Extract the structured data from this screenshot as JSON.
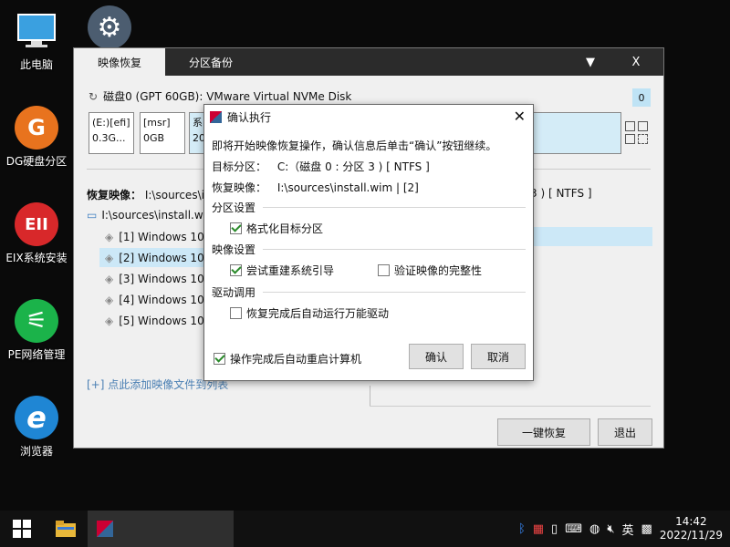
{
  "desktop": {
    "icons": [
      {
        "label": "此电脑",
        "glyph": "▭",
        "color": "#3a9ad9"
      },
      {
        "label": "DG硬盘分区",
        "glyph": "G",
        "color": "#e8731e"
      },
      {
        "label": "EIX系统安装",
        "glyph": "EII",
        "color": "#d8282a"
      },
      {
        "label": "PE网络管理",
        "glyph": "⚟",
        "color": "#1bb34a"
      },
      {
        "label": "浏览器",
        "glyph": "e",
        "color": "#1f86d4"
      }
    ],
    "settings_glyph": "⚙"
  },
  "window": {
    "tabs": [
      {
        "label": "映像恢复"
      },
      {
        "label": "分区备份"
      }
    ],
    "dropdown_glyph": "▼",
    "close_glyph": "X",
    "disk_label": "磁盘0 (GPT 60GB): VMware Virtual NVMe Disk",
    "disk_index": "0",
    "partitions": [
      {
        "line1": "(E:)[efi]",
        "line2": "0.3G..."
      },
      {
        "line1": "[msr]",
        "line2": "0GB"
      },
      {
        "line1": "系",
        "line2": "20"
      }
    ],
    "restore_label": "恢复映像：",
    "restore_value": "I:\\sources\\i",
    "target_tail": "3 ) [ NTFS ]",
    "tree_root": "I:\\sources\\install.wi",
    "tree_items": [
      {
        "label": "[1] Windows 10"
      },
      {
        "label": "[2] Windows 10"
      },
      {
        "label": "[3] Windows 10"
      },
      {
        "label": "[4] Windows 10"
      },
      {
        "label": "[5] Windows 10"
      }
    ],
    "add_link": "[+] 点此添加映像文件到列表",
    "one_key_restore": "一键恢复",
    "exit": "退出"
  },
  "dialog": {
    "title": "确认执行",
    "intro": "即将开始映像恢复操作，确认信息后单击“确认”按钮继续。",
    "target_label": "目标分区：",
    "target_value": "C:（磁盘 0 : 分区 3 ) [ NTFS ]",
    "image_label": "恢复映像：",
    "image_value": "I:\\sources\\install.wim | [2]",
    "section_partition": "分区设置",
    "format_target": "格式化目标分区",
    "section_image": "映像设置",
    "rebuild_boot": "尝试重建系统引导",
    "verify_image": "验证映像的完整性",
    "section_driver": "驱动调用",
    "auto_driver": "恢复完成后自动运行万能驱动",
    "auto_reboot": "操作完成后自动重启计算机",
    "confirm": "确认",
    "cancel": "取消",
    "checks": {
      "format_target": true,
      "rebuild_boot": true,
      "verify_image": false,
      "auto_driver": false,
      "auto_reboot": true
    }
  },
  "taskbar": {
    "ime": "英",
    "time": "14:42",
    "date": "2022/11/29"
  }
}
